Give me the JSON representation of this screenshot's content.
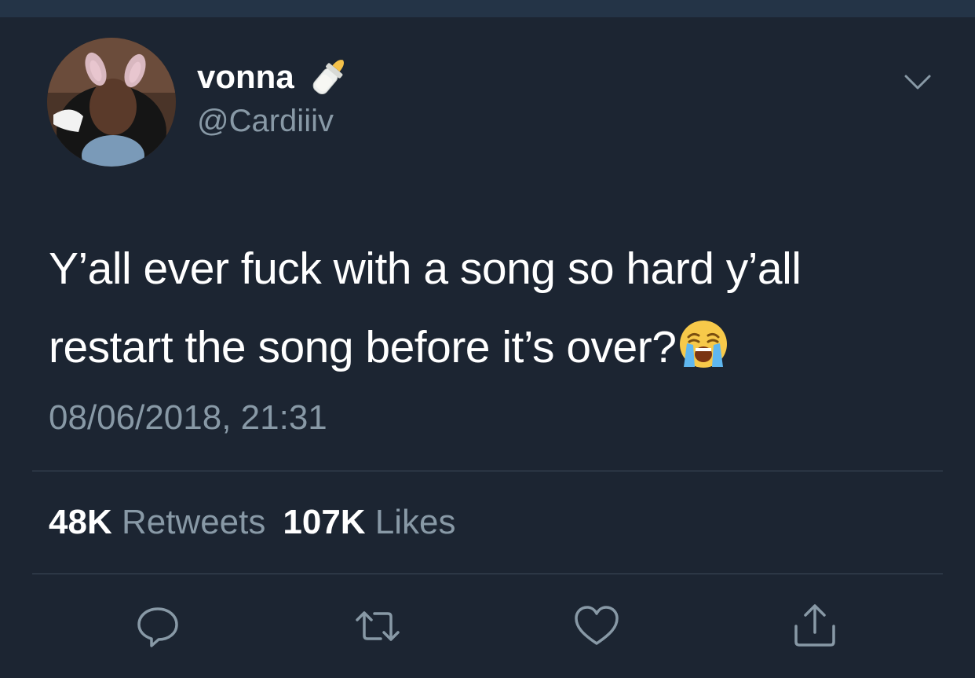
{
  "user": {
    "display_name": "vonna",
    "name_emoji": "baby-bottle-emoji",
    "handle": "@Cardiiiv"
  },
  "tweet": {
    "text_lines": [
      "Y’all ever fuck with a song so hard y’all",
      "restart the song before it’s over?"
    ],
    "text_emoji": "loudly-crying-face-emoji",
    "timestamp": "08/06/2018, 21:31"
  },
  "stats": {
    "retweets_count": "48K",
    "retweets_label": "Retweets",
    "likes_count": "107K",
    "likes_label": "Likes"
  },
  "actions": [
    "reply-icon",
    "retweet-icon",
    "like-icon",
    "share-icon"
  ],
  "colors": {
    "background": "#1c2532",
    "secondary_text": "#8899a6",
    "primary_text": "#ffffff",
    "divider": "#3d4b5a"
  }
}
